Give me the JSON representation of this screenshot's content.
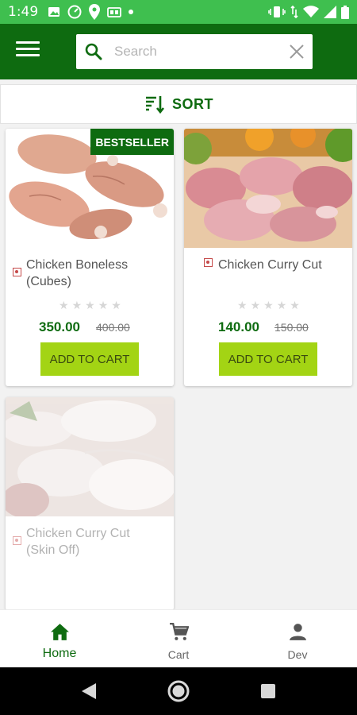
{
  "status_bar": {
    "time": "1:49"
  },
  "search": {
    "placeholder": "Search"
  },
  "sort": {
    "label": "SORT"
  },
  "products": [
    {
      "name": "Chicken Boneless (Cubes)",
      "badge": "BESTSELLER",
      "rating": 0,
      "price": "350.00",
      "mrp": "400.00",
      "button": "ADD TO CART"
    },
    {
      "name": "Chicken Curry Cut",
      "rating": 0,
      "price": "140.00",
      "mrp": "150.00",
      "button": "ADD TO CART"
    },
    {
      "name": "Chicken Curry Cut (Skin Off)"
    }
  ],
  "bottom_nav": {
    "items": [
      {
        "label": "Home",
        "icon": "home-icon",
        "active": true
      },
      {
        "label": "Cart",
        "icon": "cart-icon"
      },
      {
        "label": "Dev",
        "icon": "person-icon"
      }
    ]
  },
  "colors": {
    "status_bar": "#3fbf4f",
    "app_bar": "#0e6b10",
    "accent_green": "#0e6b10",
    "button_lime": "#a3d414"
  }
}
